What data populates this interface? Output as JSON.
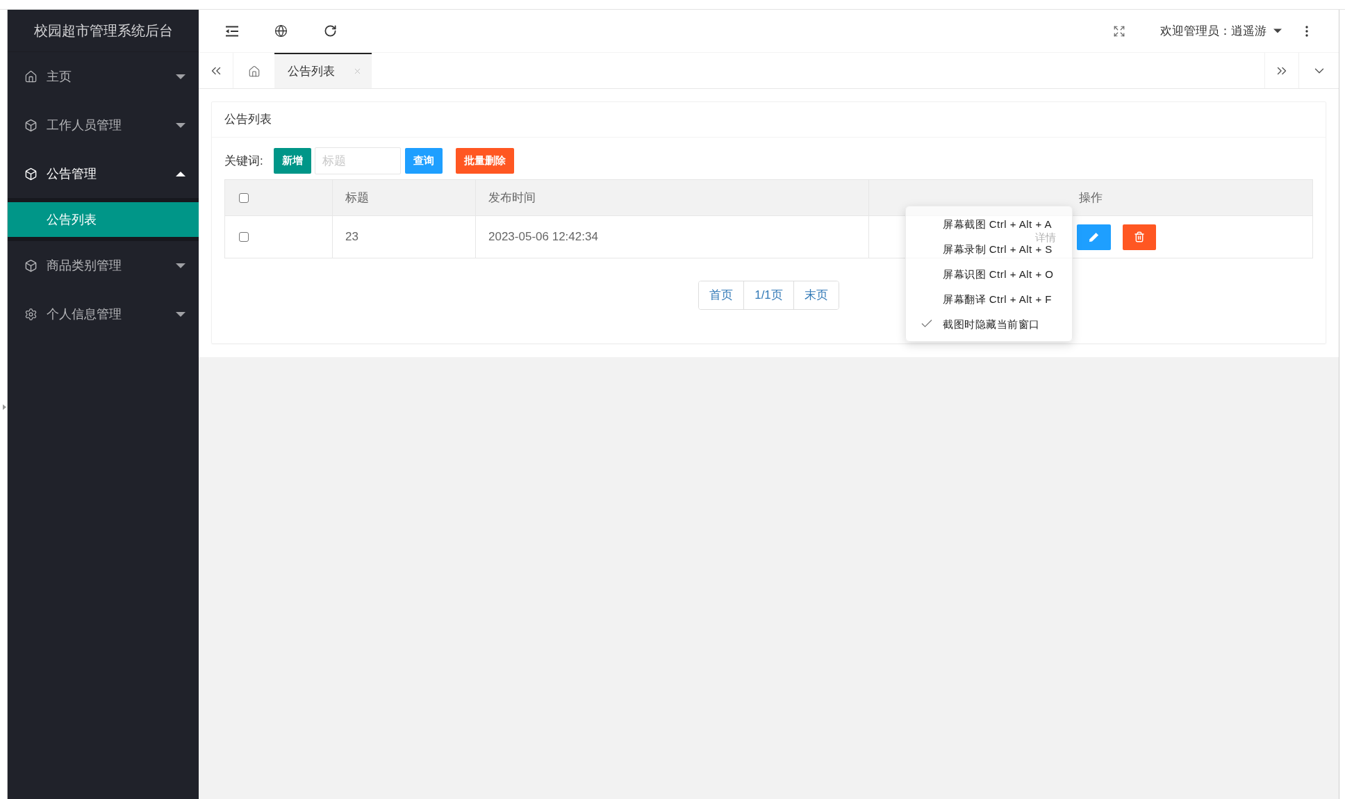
{
  "sidebar": {
    "title": "校园超市管理系统后台",
    "menu": [
      {
        "kind": "home",
        "label": "主页",
        "expanded": false
      },
      {
        "kind": "module",
        "label": "工作人员管理",
        "expanded": false
      },
      {
        "kind": "module",
        "label": "公告管理",
        "expanded": true,
        "children": [
          {
            "label": "公告列表",
            "selected": true
          }
        ]
      },
      {
        "kind": "module",
        "label": "商品类别管理",
        "expanded": false
      },
      {
        "kind": "settings",
        "label": "个人信息管理",
        "expanded": false
      }
    ]
  },
  "header": {
    "user": "欢迎管理员：逍遥游"
  },
  "tabs": [
    {
      "kind": "home",
      "selected": false
    },
    {
      "kind": "page",
      "label": "公告列表",
      "selected": true
    }
  ],
  "panel": {
    "title": "公告列表",
    "toolbar": [
      {
        "kind": "label",
        "text": "关键词:"
      },
      {
        "kind": "button",
        "label": "新增",
        "color": "#009688"
      },
      {
        "kind": "input",
        "placeholder": "标题"
      },
      {
        "kind": "button",
        "label": "查询",
        "color": "#1e9fff"
      },
      {
        "kind": "button",
        "label": "批量删除",
        "color": "#ff5722"
      }
    ],
    "table": {
      "columns": [
        {
          "kind": "checkbox",
          "checked": false
        },
        {
          "kind": "text",
          "label": "标题"
        },
        {
          "kind": "text",
          "label": "发布时间"
        },
        {
          "kind": "actions",
          "label": "操作"
        }
      ],
      "rows": [
        {
          "cells": [
            {
              "kind": "checkbox",
              "checked": false
            },
            {
              "kind": "text",
              "text": "23"
            },
            {
              "kind": "text",
              "text": "2023-05-06 12:42:34"
            },
            {
              "kind": "actions",
              "actions": [
                {
                  "kind": "text",
                  "label": "详情"
                },
                {
                  "kind": "edit",
                  "color": "#1e9fff"
                },
                {
                  "kind": "delete",
                  "color": "#ff5722"
                }
              ]
            }
          ]
        }
      ]
    },
    "pagination": [
      "首页",
      "1/1页",
      "末页"
    ]
  },
  "context_menu": {
    "items": [
      {
        "label": "屏幕截图 Ctrl + Alt + A",
        "checked": false
      },
      {
        "label": "屏幕录制 Ctrl + Alt + S",
        "checked": false
      },
      {
        "label": "屏幕识图 Ctrl + Alt + O",
        "checked": false
      },
      {
        "label": "屏幕翻译 Ctrl + Alt + F",
        "checked": false
      },
      {
        "label": "截图时隐藏当前窗口",
        "checked": true
      }
    ]
  }
}
